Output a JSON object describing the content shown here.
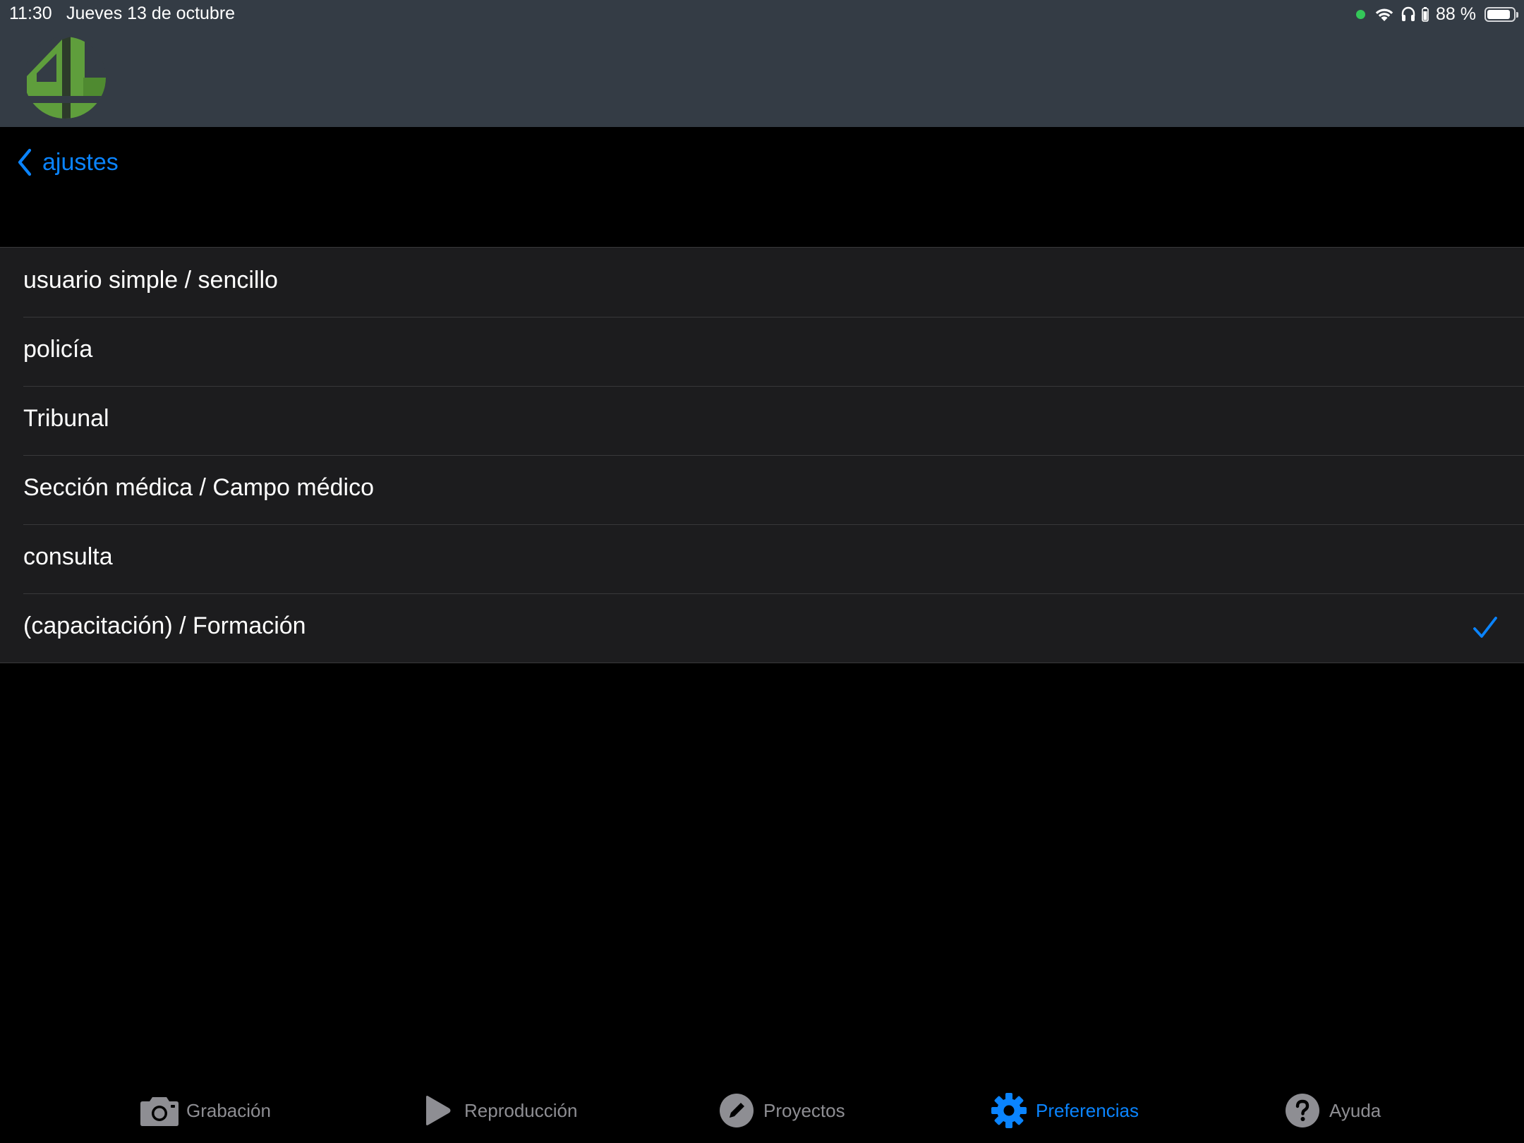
{
  "status_bar": {
    "time": "11:30",
    "date": "Jueves 13 de octubre",
    "battery_text": "88 %",
    "battery_level": 0.88
  },
  "header": {
    "logo": "app-logo-green-4"
  },
  "nav": {
    "back_label": "ajustes"
  },
  "options": [
    {
      "label": "usuario simple / sencillo",
      "selected": false
    },
    {
      "label": "policía",
      "selected": false
    },
    {
      "label": "Tribunal",
      "selected": false
    },
    {
      "label": "Sección médica / Campo médico",
      "selected": false
    },
    {
      "label": "consulta",
      "selected": false
    },
    {
      "label": "(capacitación) / Formación",
      "selected": true
    }
  ],
  "tab_bar": {
    "items": [
      {
        "label": "Grabación",
        "icon": "camera-icon",
        "active": false
      },
      {
        "label": "Reproducción",
        "icon": "play-icon",
        "active": false
      },
      {
        "label": "Proyectos",
        "icon": "pencil-icon",
        "active": false
      },
      {
        "label": "Preferencias",
        "icon": "gear-icon",
        "active": true
      },
      {
        "label": "Ayuda",
        "icon": "help-icon",
        "active": false
      }
    ]
  },
  "colors": {
    "header_bg": "#343c45",
    "accent": "#0a84ff",
    "row_bg": "#1c1c1e",
    "inactive_tab": "#8e8e93",
    "logo_green": "#5f9e3c"
  }
}
